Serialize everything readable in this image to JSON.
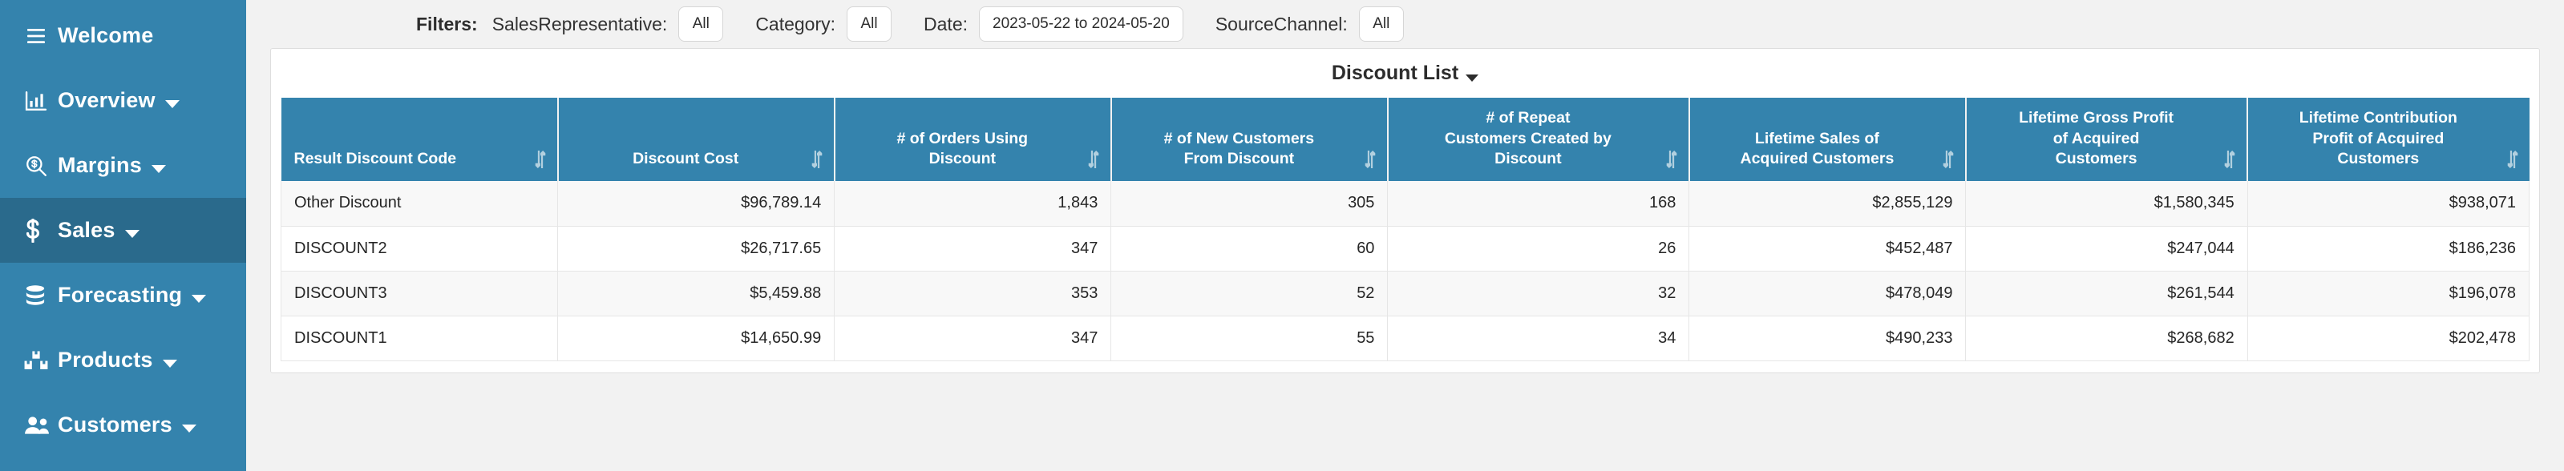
{
  "sidebar": {
    "items": [
      {
        "label": "Welcome",
        "icon": "hamburger-menu-icon",
        "has_caret": false,
        "active": false
      },
      {
        "label": "Overview",
        "icon": "bar-chart-icon",
        "has_caret": true,
        "active": false
      },
      {
        "label": "Margins",
        "icon": "magnifier-dollar-icon",
        "has_caret": true,
        "active": false
      },
      {
        "label": "Sales",
        "icon": "dollar-sign-icon",
        "has_caret": true,
        "active": true
      },
      {
        "label": "Forecasting",
        "icon": "database-icon",
        "has_caret": true,
        "active": false
      },
      {
        "label": "Products",
        "icon": "boxes-icon",
        "has_caret": true,
        "active": false
      },
      {
        "label": "Customers",
        "icon": "people-icon",
        "has_caret": true,
        "active": false
      }
    ],
    "background_color": "#3483ad",
    "active_color": "#2a6a8c"
  },
  "filters": {
    "title": "Filters:",
    "sales_representative": {
      "label": "SalesRepresentative:",
      "value": "All"
    },
    "category": {
      "label": "Category:",
      "value": "All"
    },
    "date": {
      "label": "Date:",
      "value": "2023-05-22 to 2024-05-20"
    },
    "source_channel": {
      "label": "SourceChannel:",
      "value": "All"
    }
  },
  "card": {
    "title": "Discount List"
  },
  "table": {
    "columns": [
      "Result Discount Code",
      "Discount Cost",
      "# of Orders Using Discount",
      "# of New Customers From Discount",
      "# of Repeat Customers Created by Discount",
      "Lifetime Sales of Acquired Customers",
      "Lifetime Gross Profit of Acquired Customers",
      "Lifetime Contribution Profit of Acquired Customers"
    ],
    "columns_wrapped": [
      [
        "Result Discount Code"
      ],
      [
        "Discount Cost"
      ],
      [
        "# of Orders Using",
        "Discount"
      ],
      [
        "# of New Customers",
        "From Discount"
      ],
      [
        "# of Repeat",
        "Customers Created by",
        "Discount"
      ],
      [
        "Lifetime Sales of",
        "Acquired Customers"
      ],
      [
        "Lifetime Gross Profit",
        "of Acquired",
        "Customers"
      ],
      [
        "Lifetime Contribution",
        "Profit of Acquired",
        "Customers"
      ]
    ],
    "rows": [
      {
        "result_discount_code": "Other Discount",
        "discount_cost": "$96,789.14",
        "orders_using_discount": "1,843",
        "new_customers_from_discount": "305",
        "repeat_customers_created": "168",
        "lifetime_sales": "$2,855,129",
        "lifetime_gross_profit": "$1,580,345",
        "lifetime_contribution_profit": "$938,071"
      },
      {
        "result_discount_code": "DISCOUNT2",
        "discount_cost": "$26,717.65",
        "orders_using_discount": "347",
        "new_customers_from_discount": "60",
        "repeat_customers_created": "26",
        "lifetime_sales": "$452,487",
        "lifetime_gross_profit": "$247,044",
        "lifetime_contribution_profit": "$186,236"
      },
      {
        "result_discount_code": "DISCOUNT3",
        "discount_cost": "$5,459.88",
        "orders_using_discount": "353",
        "new_customers_from_discount": "52",
        "repeat_customers_created": "32",
        "lifetime_sales": "$478,049",
        "lifetime_gross_profit": "$261,544",
        "lifetime_contribution_profit": "$196,078"
      },
      {
        "result_discount_code": "DISCOUNT1",
        "discount_cost": "$14,650.99",
        "orders_using_discount": "347",
        "new_customers_from_discount": "55",
        "repeat_customers_created": "34",
        "lifetime_sales": "$490,233",
        "lifetime_gross_profit": "$268,682",
        "lifetime_contribution_profit": "$202,478"
      }
    ]
  },
  "colors": {
    "brand_blue": "#3483ad",
    "active_blue": "#2a6a8c",
    "page_bg": "#f2f2f2",
    "row_alt": "#f8f8f8"
  }
}
